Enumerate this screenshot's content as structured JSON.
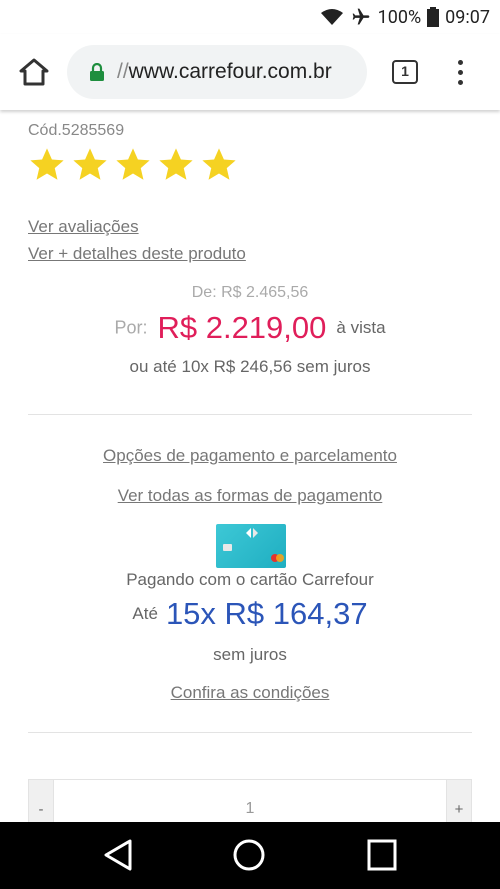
{
  "status_bar": {
    "battery": "100%",
    "time": "09:07",
    "icons": [
      "wifi-icon",
      "airplane-icon",
      "battery-icon"
    ]
  },
  "browser": {
    "url_scheme": "//",
    "url_host": "www.carrefour.com.br",
    "tab_count": "1",
    "icons": [
      "home-icon",
      "lock-icon",
      "tabs-icon",
      "overflow-menu-icon"
    ]
  },
  "product": {
    "code": "Cód.5285569",
    "rating_stars": 5,
    "ver_avaliacoes": "Ver avaliações",
    "ver_detalhes": "Ver + detalhes deste produto",
    "de_price": "De: R$ 2.465,56",
    "por_label": "Por:",
    "price": "R$ 2.219,00",
    "a_vista": "à vista",
    "parcelamento": "ou até 10x R$ 246,56 sem juros"
  },
  "payment": {
    "opcoes_link": "Opções de pagamento e parcelamento",
    "ver_todas_link": "Ver todas as formas de pagamento",
    "card_text": "Pagando com o cartão Carrefour",
    "ate_label": "Até",
    "card_price": "15x R$ 164,37",
    "sem_juros": "sem juros",
    "confira_link": "Confira as condições"
  },
  "quantity": {
    "minus": "-",
    "value": "1",
    "plus": "+"
  },
  "colors": {
    "price": "#e01e5a",
    "card_price": "#2b55b8",
    "star": "#f5d222"
  },
  "nav": {
    "icons": [
      "back-icon",
      "home-circle-icon",
      "recents-icon"
    ]
  }
}
